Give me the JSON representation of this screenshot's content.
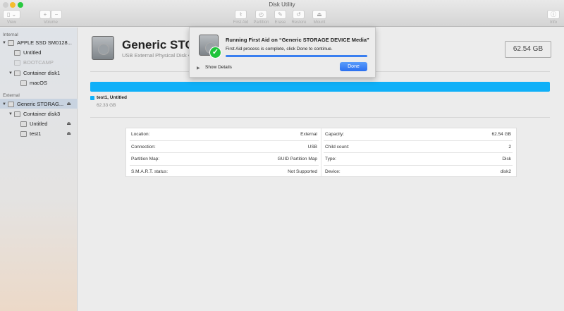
{
  "window": {
    "title": "Disk Utility"
  },
  "toolbar": {
    "view": "View",
    "volume": "Volume",
    "plus": "+",
    "minus": "−",
    "first_aid": "First Aid",
    "partition": "Partition",
    "erase": "Erase",
    "restore": "Restore",
    "mount": "Mount",
    "info": "Info"
  },
  "sidebar": {
    "internal": "Internal",
    "external": "External",
    "items": [
      "APPLE SSD SM0128...",
      "Untitled",
      "BOOTCAMP",
      "Container disk1",
      "macOS",
      "Generic STORAG...",
      "Container disk3",
      "Untitled",
      "test1"
    ]
  },
  "disk": {
    "name": "Generic STORAGE DEVICE Media",
    "name_visible": "Generic STORA",
    "subtitle": "USB External Physical Disk •",
    "size": "62.54 GB",
    "volume_label": "test1, Untitled",
    "volume_size": "62.33 GB",
    "bar_color": "#0fb0f8"
  },
  "info": {
    "left": [
      [
        "Location:",
        "External"
      ],
      [
        "Connection:",
        "USB"
      ],
      [
        "Partition Map:",
        "GUID Partition Map"
      ],
      [
        "S.M.A.R.T. status:",
        "Not Supported"
      ]
    ],
    "right": [
      [
        "Capacity:",
        "62.54 GB"
      ],
      [
        "Child count:",
        "2"
      ],
      [
        "Type:",
        "Disk"
      ],
      [
        "Device:",
        "disk2"
      ]
    ]
  },
  "dialog": {
    "title": "Running First Aid on “Generic STORAGE DEVICE Media”",
    "message": "First Aid process is complete, click Done to continue.",
    "progress": 1.0,
    "show_details": "Show Details",
    "done": "Done"
  }
}
